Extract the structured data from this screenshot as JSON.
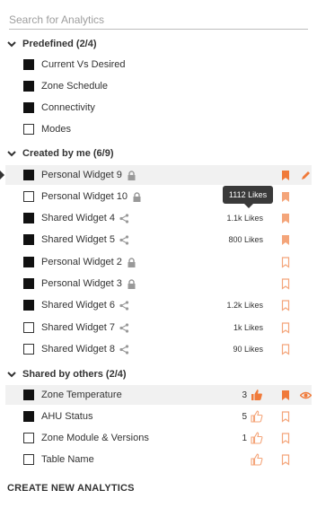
{
  "search": {
    "placeholder": "Search for Analytics",
    "value": ""
  },
  "colors": {
    "accent": "#f07a3a",
    "accent_light": "#f4a57a",
    "selected_bg": "#f1f1f1"
  },
  "sections": {
    "predefined": {
      "title": "Predefined (2/4)",
      "items": [
        {
          "label": "Current Vs Desired",
          "checked": true
        },
        {
          "label": "Zone Schedule",
          "checked": true
        },
        {
          "label": "Connectivity",
          "checked": true
        },
        {
          "label": "Modes",
          "checked": false
        }
      ]
    },
    "created": {
      "title": "Created by me (6/9)",
      "items": [
        {
          "label": "Personal Widget 9",
          "checked": true,
          "icon": "lock-icon",
          "likes": "",
          "bookmark": "filled"
        },
        {
          "label": "Personal Widget 10",
          "checked": false,
          "icon": "lock-icon",
          "likes": "",
          "bookmark": "filled"
        },
        {
          "label": "Shared Widget 4",
          "checked": true,
          "icon": "share-icon",
          "likes": "1.1k Likes",
          "bookmark": "filled"
        },
        {
          "label": "Shared Widget 5",
          "checked": true,
          "icon": "share-icon",
          "likes": "800 Likes",
          "bookmark": "filled"
        },
        {
          "label": "Personal Widget 2",
          "checked": true,
          "icon": "lock-icon",
          "likes": "",
          "bookmark": "outline"
        },
        {
          "label": "Personal Widget 3",
          "checked": true,
          "icon": "lock-icon",
          "likes": "",
          "bookmark": "outline"
        },
        {
          "label": "Shared Widget 6",
          "checked": true,
          "icon": "share-icon",
          "likes": "1.2k Likes",
          "bookmark": "outline"
        },
        {
          "label": "Shared Widget 7",
          "checked": false,
          "icon": "share-icon",
          "likes": "1k Likes",
          "bookmark": "outline"
        },
        {
          "label": "Shared Widget 8",
          "checked": false,
          "icon": "share-icon",
          "likes": "90 Likes",
          "bookmark": "outline"
        }
      ],
      "tooltip": "1112 Likes"
    },
    "shared": {
      "title": "Shared by others (2/4)",
      "items": [
        {
          "label": "Zone Temperature",
          "checked": true,
          "likes": "3",
          "thumb": "filled",
          "bookmark": "filled"
        },
        {
          "label": "AHU Status",
          "checked": true,
          "likes": "5",
          "thumb": "outline",
          "bookmark": "outline"
        },
        {
          "label": "Zone Module & Versions",
          "checked": false,
          "likes": "1",
          "thumb": "outline",
          "bookmark": "outline"
        },
        {
          "label": "Table Name",
          "checked": false,
          "likes": "",
          "thumb": "outline",
          "bookmark": "outline"
        }
      ]
    }
  },
  "create_label": "CREATE NEW ANALYTICS"
}
